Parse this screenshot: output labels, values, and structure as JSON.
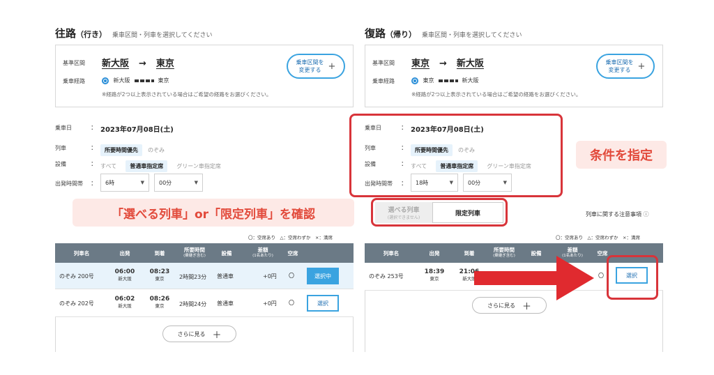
{
  "outbound": {
    "title": "往路",
    "title_sub": "（行き）",
    "hint": "乗車区間・列車を選択してください",
    "segment_label": "基準区間",
    "from": "新大阪",
    "arrow": "→",
    "to": "東京",
    "route_label": "乗車経路",
    "route_from": "新大阪",
    "route_to": "東京",
    "route_note": "※経路が2つ以上表示されている場合はご希望の経路をお選びください。",
    "change_btn": "乗車区間を\n変更する",
    "date_label": "乗車日",
    "date": "2023年07月08日(土)",
    "train_label": "列車",
    "train_chip": "所要時間優先",
    "train_opt": "のぞみ",
    "facility_label": "設備",
    "facility_all": "すべて",
    "facility_chip": "普通車指定席",
    "facility_green": "グリーン車指定席",
    "time_label": "出発時間帯",
    "hour": "6時",
    "minute": "00分"
  },
  "return": {
    "title": "復路",
    "title_sub": "（帰り）",
    "hint": "乗車区間・列車を選択してください",
    "segment_label": "基準区間",
    "from": "東京",
    "arrow": "→",
    "to": "新大阪",
    "route_label": "乗車経路",
    "route_from": "東京",
    "route_to": "新大阪",
    "route_note": "※経路が2つ以上表示されている場合はご希望の経路をお選びください。",
    "change_btn": "乗車区間を\n変更する",
    "date_label": "乗車日",
    "date": "2023年07月08日(土)",
    "train_label": "列車",
    "train_chip": "所要時間優先",
    "train_opt": "のぞみ",
    "facility_label": "設備",
    "facility_all": "すべて",
    "facility_chip": "普通車指定席",
    "facility_green": "グリーン車指定席",
    "time_label": "出発時間帯",
    "hour": "18時",
    "minute": "00分"
  },
  "colon": "：",
  "callout_conditions": "条件を指定",
  "callout_check": "「選べる列車」or「限定列車」を確認",
  "tabs": {
    "selectable": "選べる列車",
    "selectable_sub": "(選択できません)",
    "limited": "限定列車",
    "notice": "列車に関する注意事項",
    "notice_icon": "ⓘ"
  },
  "legend": "〇：空席あり　△：空席わずか　×：満席",
  "table": {
    "headers": [
      "列車名",
      "出発",
      "到着",
      "所要時間",
      "設備",
      "差額",
      "空席"
    ],
    "header_subs": {
      "duration": "(乗継ぎ含む)",
      "diff": "(1名あたり)"
    },
    "rows_left": [
      {
        "name": "のぞみ 200号",
        "dep": "06:00",
        "dep_st": "新大阪",
        "arr": "08:23",
        "arr_st": "東京",
        "dur": "2時間23分",
        "fac": "普通車",
        "diff": "+0円",
        "seat": "〇",
        "btn": "選択中"
      },
      {
        "name": "のぞみ 202号",
        "dep": "06:02",
        "dep_st": "新大阪",
        "arr": "08:26",
        "arr_st": "東京",
        "dur": "2時間24分",
        "fac": "普通車",
        "diff": "+0円",
        "seat": "〇",
        "btn": "選択"
      }
    ],
    "rows_right": [
      {
        "name": "のぞみ 253号",
        "dep": "18:39",
        "dep_st": "東京",
        "arr": "21:06",
        "arr_st": "新大阪",
        "seat": "〇",
        "btn": "選択"
      }
    ]
  },
  "more_btn": "さらに見る",
  "plus": "＋",
  "colors": {
    "accent": "#3aa3e0",
    "callout_red": "#e24a3b",
    "table_header": "#6b7a86",
    "highlight_row": "#e8f3fb"
  }
}
